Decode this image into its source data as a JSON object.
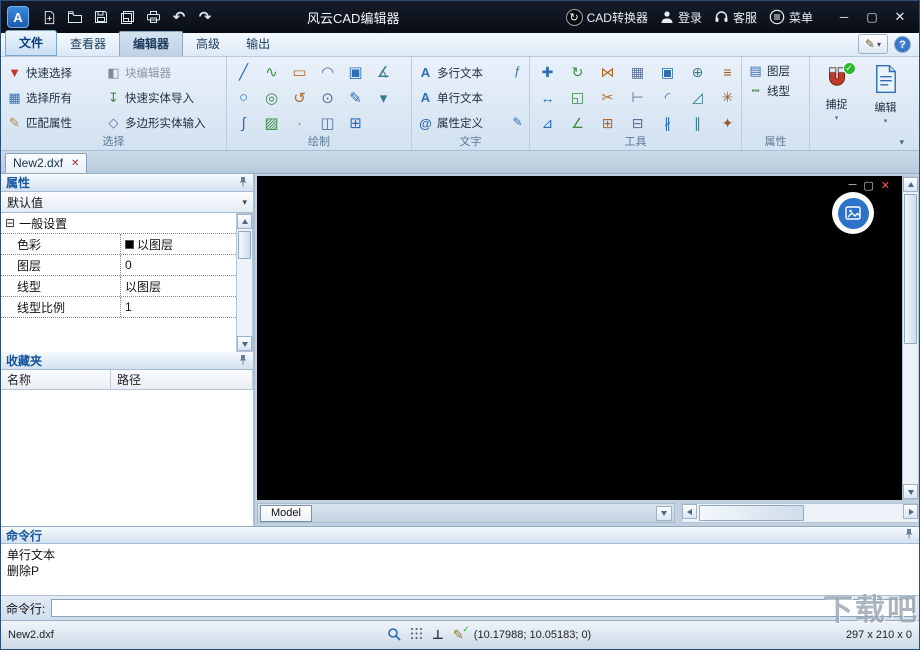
{
  "titlebar": {
    "app_logo_text": "A",
    "title": "风云CAD编辑器",
    "quick_access": [
      "new-file",
      "open-file",
      "save-file",
      "save-all",
      "print",
      "undo",
      "redo"
    ],
    "actions": [
      {
        "label": "CAD转换器"
      },
      {
        "label": "登录"
      },
      {
        "label": "客服"
      },
      {
        "label": "菜单"
      }
    ],
    "window_controls": {
      "minimize": "─",
      "maximize": "▢",
      "close": "✕"
    }
  },
  "ribbon_tabs": [
    {
      "label": "文件"
    },
    {
      "label": "查看器"
    },
    {
      "label": "编辑器",
      "active": true
    },
    {
      "label": "高级"
    },
    {
      "label": "输出"
    }
  ],
  "tabs_right": {
    "help": "?"
  },
  "ribbon": {
    "selection": {
      "label": "选择",
      "buttons": [
        {
          "label": "快速选择"
        },
        {
          "label": "块编辑器",
          "disabled": true
        },
        {
          "label": "选择所有"
        },
        {
          "label": "快速实体导入"
        },
        {
          "label": "匹配属性"
        },
        {
          "label": "多边形实体输入"
        }
      ]
    },
    "draw": {
      "label": "绘制",
      "rows": [
        [
          "line",
          "polyline",
          "rectangle",
          "revision-cloud",
          "region",
          "dimension"
        ],
        [
          "circle",
          "ellipse",
          "arc",
          "donut",
          "sketch",
          "more-draw"
        ],
        [
          "spline",
          "hatch",
          "point",
          "raster-image",
          "table"
        ]
      ]
    },
    "text": {
      "label": "文字",
      "buttons": [
        {
          "label": "多行文本"
        },
        {
          "label": "单行文本"
        },
        {
          "label": "属性定义"
        }
      ]
    },
    "tools": {
      "label": "工具",
      "rows": [
        [
          "move",
          "rotate",
          "mirror",
          "array",
          "copy",
          "join",
          "group"
        ],
        [
          "stretch",
          "scale",
          "trim",
          "extend",
          "fillet",
          "chamfer",
          "explode"
        ],
        [
          "measure",
          "angle",
          "align",
          "break",
          "divide",
          "offset",
          "purge"
        ]
      ]
    },
    "properties": {
      "label": "属性",
      "buttons": [
        {
          "label": "图层"
        },
        {
          "label": "线型"
        }
      ]
    },
    "big_buttons": [
      {
        "label": "捕捉"
      },
      {
        "label": "编辑"
      }
    ]
  },
  "icon_glyphs": {
    "undo": "↶",
    "redo": "↷",
    "close": "✕",
    "pencil": "✎",
    "collapse": "⊟",
    "quick_select": "▼",
    "block_editor": "◧",
    "select_all": "▦",
    "quick_import": "↧",
    "match_props": "✎",
    "polygon_input": "◇",
    "multiline_text": "A",
    "single_line_text": "A",
    "attr_def": "@",
    "field": "ƒ",
    "edit_text": "✎",
    "layer": "▤",
    "linetype": "┅",
    "line": "╱",
    "polyline": "∿",
    "rectangle": "▭",
    "revision-cloud": "◠",
    "region": "▣",
    "dimension": "∡",
    "circle": "○",
    "ellipse": "◎",
    "arc": "↺",
    "donut": "⊙",
    "sketch": "✎",
    "more-draw": "▾",
    "spline": "∫",
    "hatch": "▨",
    "point": "∙",
    "raster-image": "◫",
    "table": "⊞",
    "move": "✚",
    "rotate": "↻",
    "mirror": "⋈",
    "array": "▦",
    "copy": "▣",
    "join": "⊕",
    "group": "≡",
    "stretch": "↔",
    "scale": "◱",
    "trim": "✂",
    "extend": "⊢",
    "fillet": "◜",
    "chamfer": "◿",
    "explode": "✳",
    "measure": "⊿",
    "angle": "∠",
    "align": "⊞",
    "break": "⊟",
    "divide": "∦",
    "offset": "∥",
    "purge": "✦"
  },
  "document_tabs": [
    {
      "label": "New2.dxf"
    }
  ],
  "properties_panel": {
    "title": "属性",
    "preset": "默认值",
    "section": "一般设置",
    "rows": [
      {
        "label": "色彩",
        "value": "以图层",
        "swatch": "#000000"
      },
      {
        "label": "图层",
        "value": "0"
      },
      {
        "label": "线型",
        "value": "以图层"
      },
      {
        "label": "线型比例",
        "value": "1"
      }
    ]
  },
  "favorites_panel": {
    "title": "收藏夹",
    "columns": [
      "名称",
      "路径"
    ]
  },
  "canvas": {
    "model_tab_label": "Model",
    "controls": {
      "minimize": "─",
      "restore": "▢",
      "close": "✕"
    }
  },
  "command_panel": {
    "title": "命令行",
    "history": [
      "单行文本",
      "删除P"
    ],
    "prompt": "命令行:"
  },
  "statusbar": {
    "filename": "New2.dxf",
    "coordinates": "(10.17988; 10.05183; 0)",
    "paper_size": "297 x 210 x 0"
  },
  "watermark": "下载吧",
  "colors": {
    "accent_blue": "#1e5fa8",
    "titlebar_bg": "#0d121c",
    "canvas_bg": "#000000",
    "snap_check_green": "#2eb82e",
    "close_overlay_red": "#ff5a52"
  }
}
